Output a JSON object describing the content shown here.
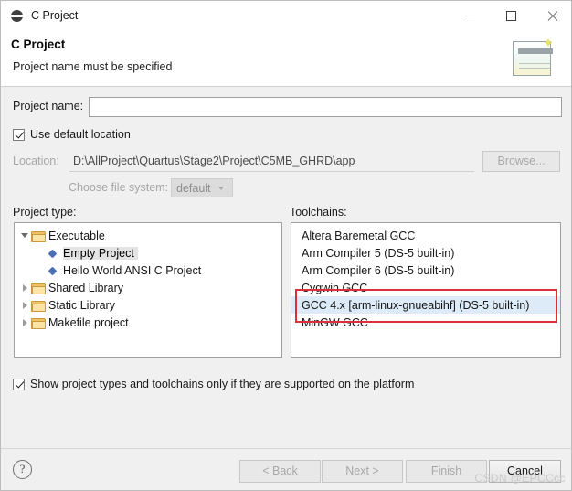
{
  "window": {
    "title": "C Project",
    "icon": "c-project-icon",
    "controls": {
      "minimize": "minimize-icon",
      "maximize": "maximize-icon",
      "close": "close-icon"
    }
  },
  "banner": {
    "title": "C Project",
    "message": "Project name must be specified",
    "icon": "new-c-project-banner-icon"
  },
  "form": {
    "project_name_label": "Project name:",
    "project_name_value": "",
    "project_name_placeholder": "",
    "use_default_location_label": "Use default location",
    "use_default_location_checked": true,
    "location_label": "Location:",
    "location_value": "D:\\AllProject\\Quartus\\Stage2\\Project\\C5MB_GHRD\\app",
    "browse_label": "Browse...",
    "browse_enabled": false,
    "choose_file_system_label": "Choose file system:",
    "choose_file_system_value": "default",
    "choose_file_system_enabled": false
  },
  "project_type": {
    "label": "Project type:",
    "rows": [
      {
        "label": "Executable",
        "indent": 0,
        "icon": "folder-icon",
        "twisty": "open",
        "selected": false
      },
      {
        "label": "Empty Project",
        "indent": 1,
        "icon": "bullet-icon",
        "twisty": "none",
        "selected": true
      },
      {
        "label": "Hello World ANSI C Project",
        "indent": 1,
        "icon": "bullet-icon",
        "twisty": "none",
        "selected": false
      },
      {
        "label": "Shared Library",
        "indent": 0,
        "icon": "folder-icon",
        "twisty": "closed",
        "selected": false
      },
      {
        "label": "Static Library",
        "indent": 0,
        "icon": "folder-icon",
        "twisty": "closed",
        "selected": false
      },
      {
        "label": "Makefile project",
        "indent": 0,
        "icon": "folder-icon",
        "twisty": "closed",
        "selected": false
      }
    ]
  },
  "toolchains": {
    "label": "Toolchains:",
    "rows": [
      {
        "label": "Altera Baremetal GCC",
        "selected": false
      },
      {
        "label": "Arm Compiler 5 (DS-5 built-in)",
        "selected": false
      },
      {
        "label": "Arm Compiler 6 (DS-5 built-in)",
        "selected": false
      },
      {
        "label": "Cygwin GCC",
        "selected": false
      },
      {
        "label": "GCC 4.x [arm-linux-gnueabihf] (DS-5 built-in)",
        "selected": true
      },
      {
        "label": "MinGW GCC",
        "selected": false
      }
    ]
  },
  "options": {
    "show_supported_label": "Show project types and toolchains only if they are supported on the platform",
    "show_supported_checked": true
  },
  "footer": {
    "help_label": "?",
    "buttons": [
      {
        "label": "< Back",
        "enabled": false
      },
      {
        "label": "Next >",
        "enabled": false
      },
      {
        "label": "Finish",
        "enabled": false
      },
      {
        "label": "Cancel",
        "enabled": true
      }
    ],
    "watermark": "CSDN @EPCCcc"
  },
  "colors": {
    "annotation": "#d9303a",
    "selection": "#dcebf7",
    "accent_folder": "#f0c064"
  }
}
